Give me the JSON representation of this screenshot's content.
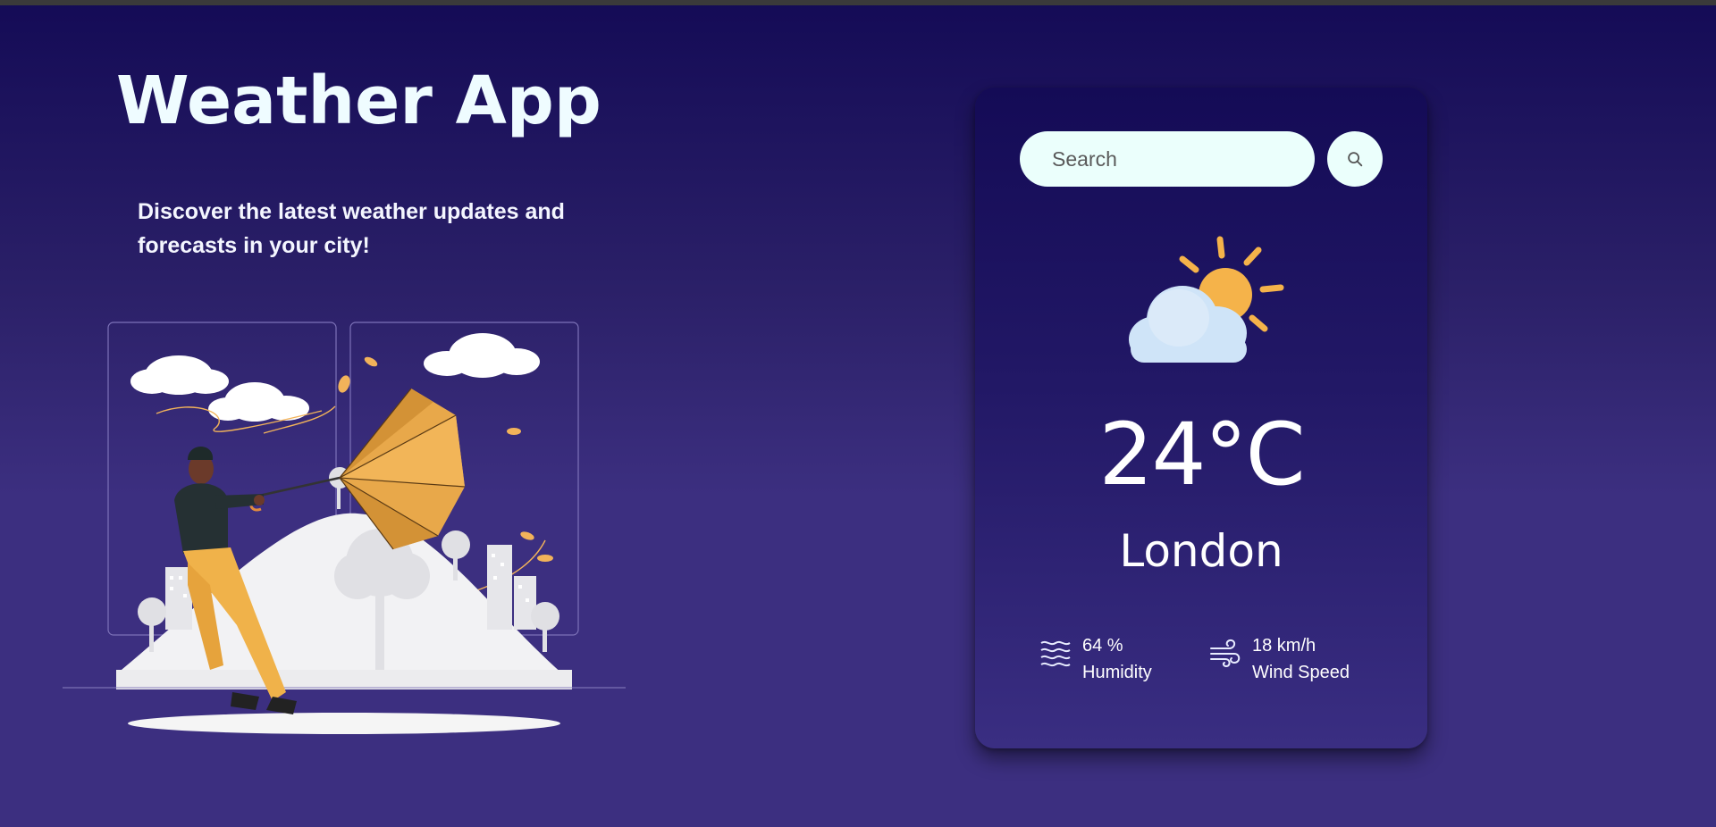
{
  "app": {
    "title": "Weather App",
    "tagline": "Discover the latest weather updates and forecasts in your city!"
  },
  "search": {
    "placeholder": "Search",
    "value": "",
    "button_icon": "search-icon"
  },
  "weather": {
    "icon": "sun-behind-cloud-icon",
    "temperature": "24°C",
    "city": "London",
    "humidity": {
      "icon": "humidity-waves-icon",
      "value": "64 %",
      "label": "Humidity"
    },
    "wind": {
      "icon": "wind-icon",
      "value": "18 km/h",
      "label": "Wind Speed"
    }
  },
  "colors": {
    "background_top": "#140b56",
    "background_bottom": "#3c2f80",
    "input_bg": "#ebfffc",
    "sun": "#f5b34a",
    "umbrella": "#e8a84a"
  }
}
